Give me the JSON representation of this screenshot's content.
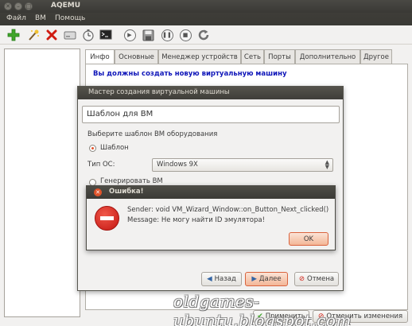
{
  "window": {
    "title": "AQEMU"
  },
  "menu": [
    "Файл",
    "ВМ",
    "Помощь"
  ],
  "tabs": [
    "Инфо",
    "Основные",
    "Менеджер устройств",
    "Сеть",
    "Порты",
    "Дополнительно",
    "Другое"
  ],
  "info": {
    "text": "Вы должны создать новую виртуальную машину"
  },
  "footer": {
    "apply_label": "Применить",
    "discard_label": "Отменить изменения"
  },
  "wizard": {
    "title": "Мастер создания виртуальной машины",
    "vm_name_value": "Шаблон для ВМ",
    "select_template_label": "Выберите шаблон ВМ оборудования",
    "template_option": "Шаблон",
    "os_type_label": "Тип ОС:",
    "os_type_value": "Windows 9X",
    "generate_option": "Генерировать ВМ",
    "back_label": "Назад",
    "next_label": "Далее",
    "cancel_label": "Отмена"
  },
  "error": {
    "title": "Ошибка!",
    "sender": "Sender: void VM_Wizard_Window::on_Button_Next_clicked()",
    "message": "Message: Не могу найти ID эмулятора!",
    "ok_label": "OK"
  },
  "watermark": "oldgames-ubuntu.blogspot.com",
  "colors": {
    "accent": "#e2552e",
    "info_text": "#0f16b9",
    "titlebar": "#3c3b37"
  }
}
